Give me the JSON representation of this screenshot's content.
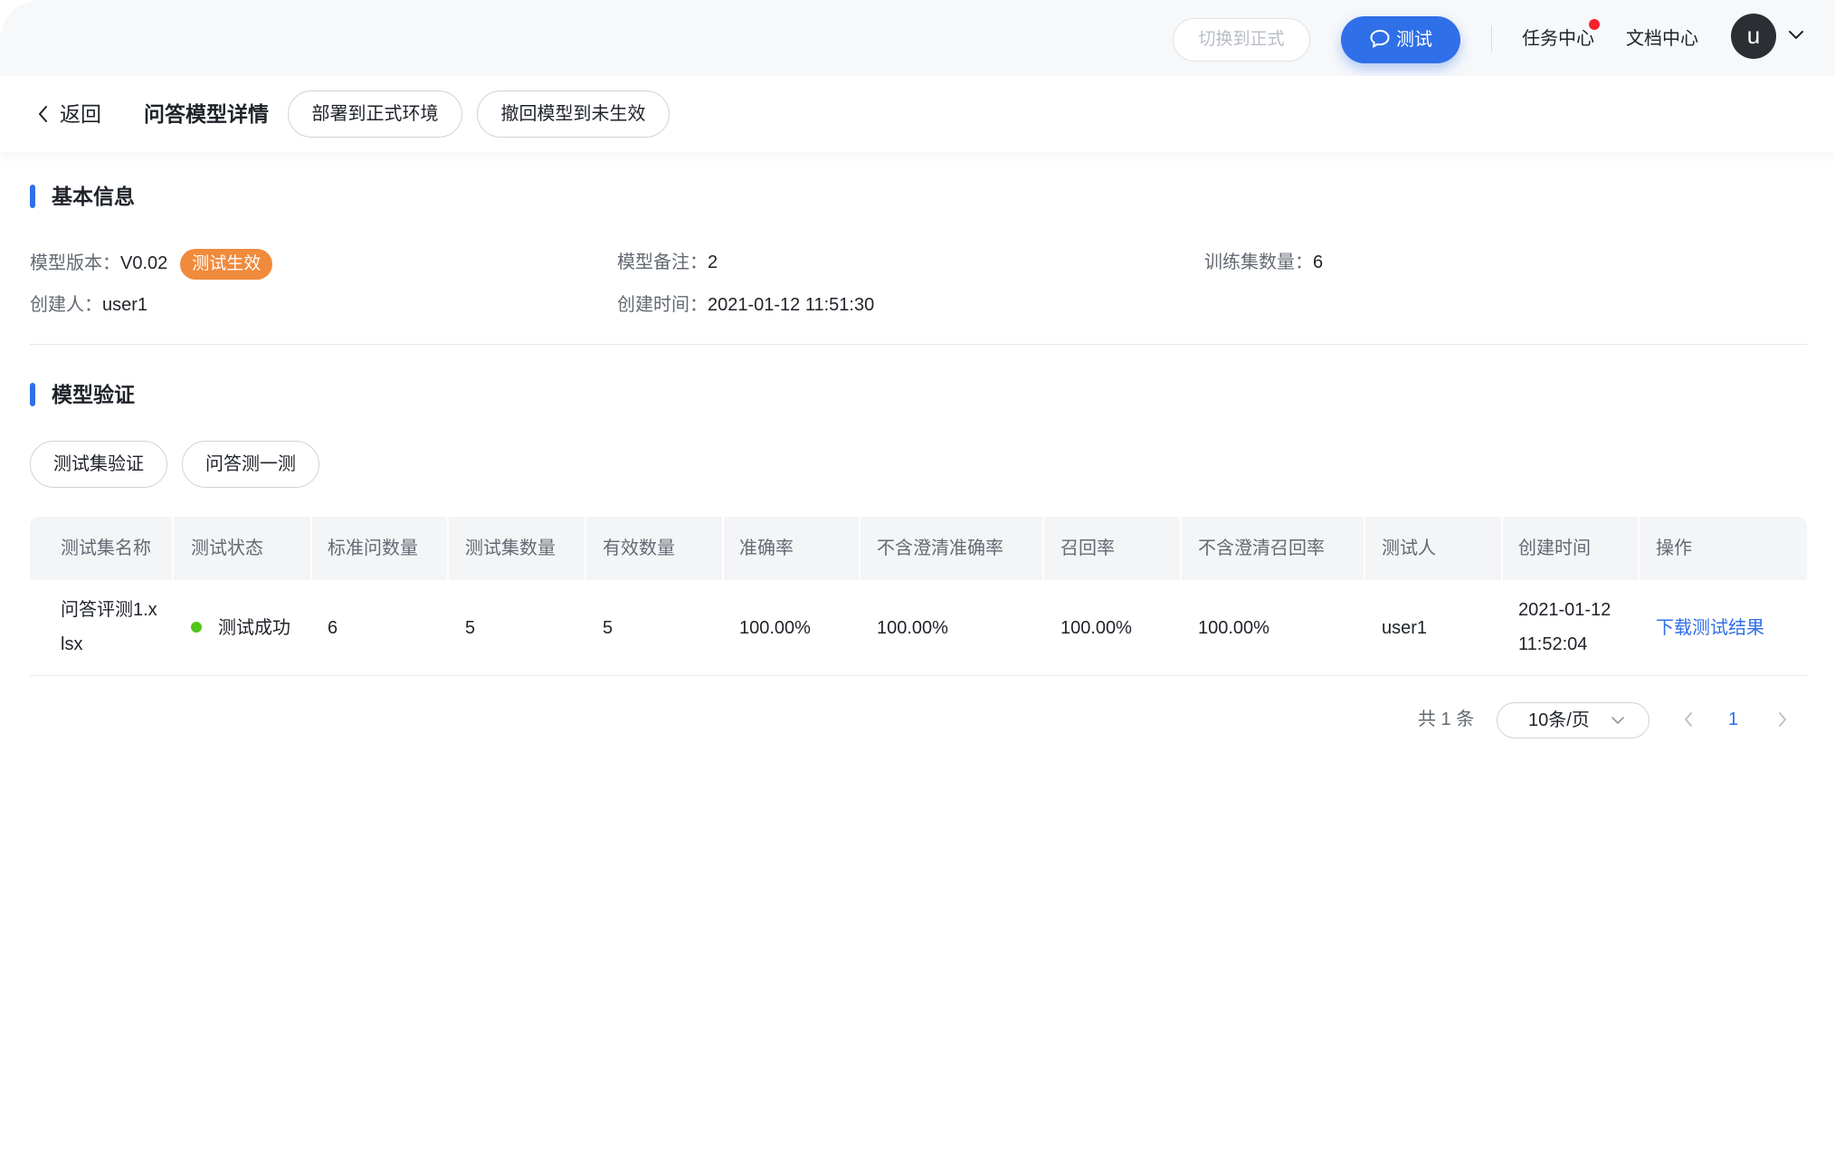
{
  "topbar": {
    "switch_label": "切换到正式",
    "test_label": "测试",
    "task_center": "任务中心",
    "doc_center": "文档中心",
    "avatar_initial": "u"
  },
  "header": {
    "back_label": "返回",
    "title": "问答模型详情",
    "deploy_label": "部署到正式环境",
    "revoke_label": "撤回模型到未生效"
  },
  "basic": {
    "section_title": "基本信息",
    "version_key": "模型版本：",
    "version_val": "V0.02",
    "status_tag": "测试生效",
    "note_key": "模型备注：",
    "note_val": "2",
    "train_key": "训练集数量：",
    "train_val": "6",
    "creator_key": "创建人：",
    "creator_val": "user1",
    "created_key": "创建时间：",
    "created_val": "2021-01-12 11:51:30"
  },
  "verify": {
    "section_title": "模型验证",
    "testset_btn": "测试集验证",
    "qa_btn": "问答测一测"
  },
  "table": {
    "headers": [
      "测试集名称",
      "测试状态",
      "标准问数量",
      "测试集数量",
      "有效数量",
      "准确率",
      "不含澄清准确率",
      "召回率",
      "不含澄清召回率",
      "测试人",
      "创建时间",
      "操作"
    ],
    "rows": [
      {
        "name": "问答评测1.xlsx",
        "status": "测试成功",
        "std_count": "6",
        "test_count": "5",
        "valid_count": "5",
        "accuracy": "100.00%",
        "accuracy_nc": "100.00%",
        "recall": "100.00%",
        "recall_nc": "100.00%",
        "tester": "user1",
        "created": "2021-01-12 11:52:04",
        "action": "下载测试结果"
      }
    ]
  },
  "pagination": {
    "total": "共 1 条",
    "page_size": "10条/页",
    "current": "1"
  },
  "colors": {
    "primary": "#2f6fe8",
    "tag_orange": "#f08a3c",
    "success_green": "#52c41a",
    "notify_red": "#f5222d"
  }
}
